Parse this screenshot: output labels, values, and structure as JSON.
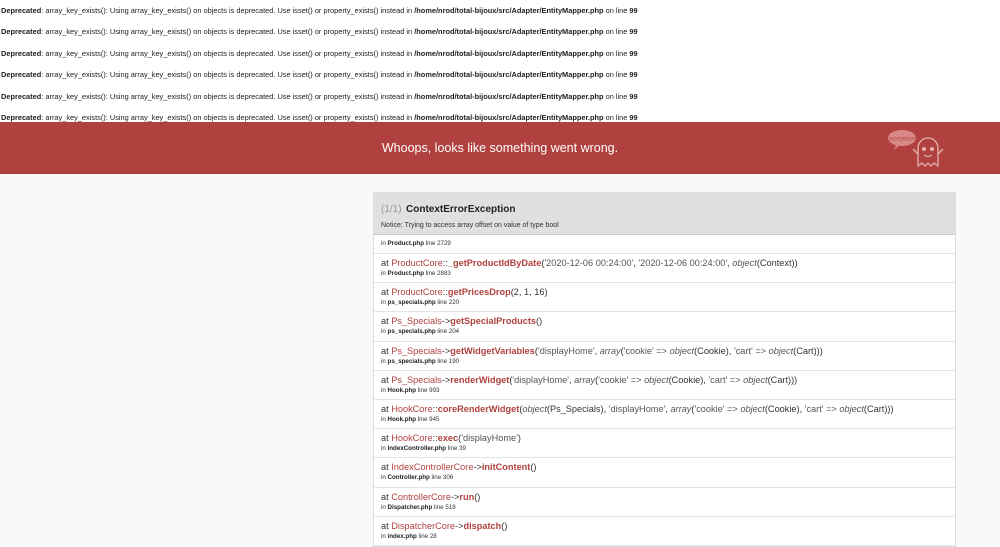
{
  "deprecations": [
    {
      "label": "Deprecated",
      "text": ": array_key_exists(): Using array_key_exists() on objects is deprecated. Use isset() or property_exists() instead in ",
      "path": "/home/nrod/total-bijoux/src/Adapter/EntityMapper.php",
      "suffix": " on line ",
      "line": "99"
    },
    {
      "label": "Deprecated",
      "text": ": array_key_exists(): Using array_key_exists() on objects is deprecated. Use isset() or property_exists() instead in ",
      "path": "/home/nrod/total-bijoux/src/Adapter/EntityMapper.php",
      "suffix": " on line ",
      "line": "99"
    },
    {
      "label": "Deprecated",
      "text": ": array_key_exists(): Using array_key_exists() on objects is deprecated. Use isset() or property_exists() instead in ",
      "path": "/home/nrod/total-bijoux/src/Adapter/EntityMapper.php",
      "suffix": " on line ",
      "line": "99"
    },
    {
      "label": "Deprecated",
      "text": ": array_key_exists(): Using array_key_exists() on objects is deprecated. Use isset() or property_exists() instead in ",
      "path": "/home/nrod/total-bijoux/src/Adapter/EntityMapper.php",
      "suffix": " on line ",
      "line": "99"
    },
    {
      "label": "Deprecated",
      "text": ": array_key_exists(): Using array_key_exists() on objects is deprecated. Use isset() or property_exists() instead in ",
      "path": "/home/nrod/total-bijoux/src/Adapter/EntityMapper.php",
      "suffix": " on line ",
      "line": "99"
    },
    {
      "label": "Deprecated",
      "text": ": array_key_exists(): Using array_key_exists() on objects is deprecated. Use isset() or property_exists() instead in ",
      "path": "/home/nrod/total-bijoux/src/Adapter/EntityMapper.php",
      "suffix": " on line ",
      "line": "99"
    }
  ],
  "banner": {
    "title": "Whoops, looks like something went wrong.",
    "mascot_text": "Exception!",
    "color": "#b0413e"
  },
  "exception": {
    "count": "(1/1)",
    "class": "ContextErrorException",
    "message": "Notice: Trying to access array offset on value of type bool",
    "file": "Product.php",
    "line": "2729"
  },
  "trace": [
    {
      "class": "ProductCore",
      "type": "::",
      "fn": "_getProductIdByDate",
      "args": [
        [
          "s",
          "'2020-12-06 00:24:00'"
        ],
        [
          "p",
          ", "
        ],
        [
          "s",
          "'2020-12-06 00:24:00'"
        ],
        [
          "p",
          ", "
        ],
        [
          "i",
          "object"
        ],
        [
          "p",
          "(Context)"
        ]
      ],
      "file": "Product.php",
      "line": "2883"
    },
    {
      "class": "ProductCore",
      "type": "::",
      "fn": "getPricesDrop",
      "args": [
        [
          "p",
          "2, 1, 16"
        ]
      ],
      "file": "ps_specials.php",
      "line": "220"
    },
    {
      "class": "Ps_Specials",
      "type": "->",
      "fn": "getSpecialProducts",
      "args": [],
      "file": "ps_specials.php",
      "line": "204"
    },
    {
      "class": "Ps_Specials",
      "type": "->",
      "fn": "getWidgetVariables",
      "args": [
        [
          "s",
          "'displayHome'"
        ],
        [
          "p",
          ", "
        ],
        [
          "i",
          "array"
        ],
        [
          "p",
          "("
        ],
        [
          "s",
          "'cookie' => "
        ],
        [
          "i",
          "object"
        ],
        [
          "p",
          "(Cookie), "
        ],
        [
          "s",
          "'cart' => "
        ],
        [
          "i",
          "object"
        ],
        [
          "p",
          "(Cart))"
        ]
      ],
      "file": "ps_specials.php",
      "line": "190"
    },
    {
      "class": "Ps_Specials",
      "type": "->",
      "fn": "renderWidget",
      "args": [
        [
          "s",
          "'displayHome'"
        ],
        [
          "p",
          ", "
        ],
        [
          "i",
          "array"
        ],
        [
          "p",
          "("
        ],
        [
          "s",
          "'cookie' => "
        ],
        [
          "i",
          "object"
        ],
        [
          "p",
          "(Cookie), "
        ],
        [
          "s",
          "'cart' => "
        ],
        [
          "i",
          "object"
        ],
        [
          "p",
          "(Cart))"
        ]
      ],
      "file": "Hook.php",
      "line": "993"
    },
    {
      "class": "HookCore",
      "type": "::",
      "fn": "coreRenderWidget",
      "args": [
        [
          "i",
          "object"
        ],
        [
          "p",
          "(Ps_Specials), "
        ],
        [
          "s",
          "'displayHome'"
        ],
        [
          "p",
          ", "
        ],
        [
          "i",
          "array"
        ],
        [
          "p",
          "("
        ],
        [
          "s",
          "'cookie' => "
        ],
        [
          "i",
          "object"
        ],
        [
          "p",
          "(Cookie), "
        ],
        [
          "s",
          "'cart' => "
        ],
        [
          "i",
          "object"
        ],
        [
          "p",
          "(Cart))"
        ]
      ],
      "file": "Hook.php",
      "line": "945"
    },
    {
      "class": "HookCore",
      "type": "::",
      "fn": "exec",
      "args": [
        [
          "s",
          "'displayHome'"
        ]
      ],
      "file": "IndexController.php",
      "line": "39"
    },
    {
      "class": "IndexControllerCore",
      "type": "->",
      "fn": "initContent",
      "args": [],
      "file": "Controller.php",
      "line": "306"
    },
    {
      "class": "ControllerCore",
      "type": "->",
      "fn": "run",
      "args": [],
      "file": "Dispatcher.php",
      "line": "518"
    },
    {
      "class": "DispatcherCore",
      "type": "->",
      "fn": "dispatch",
      "args": [],
      "file": "index.php",
      "line": "28"
    }
  ],
  "labels": {
    "at": "at ",
    "in": "in ",
    "line": " line "
  }
}
